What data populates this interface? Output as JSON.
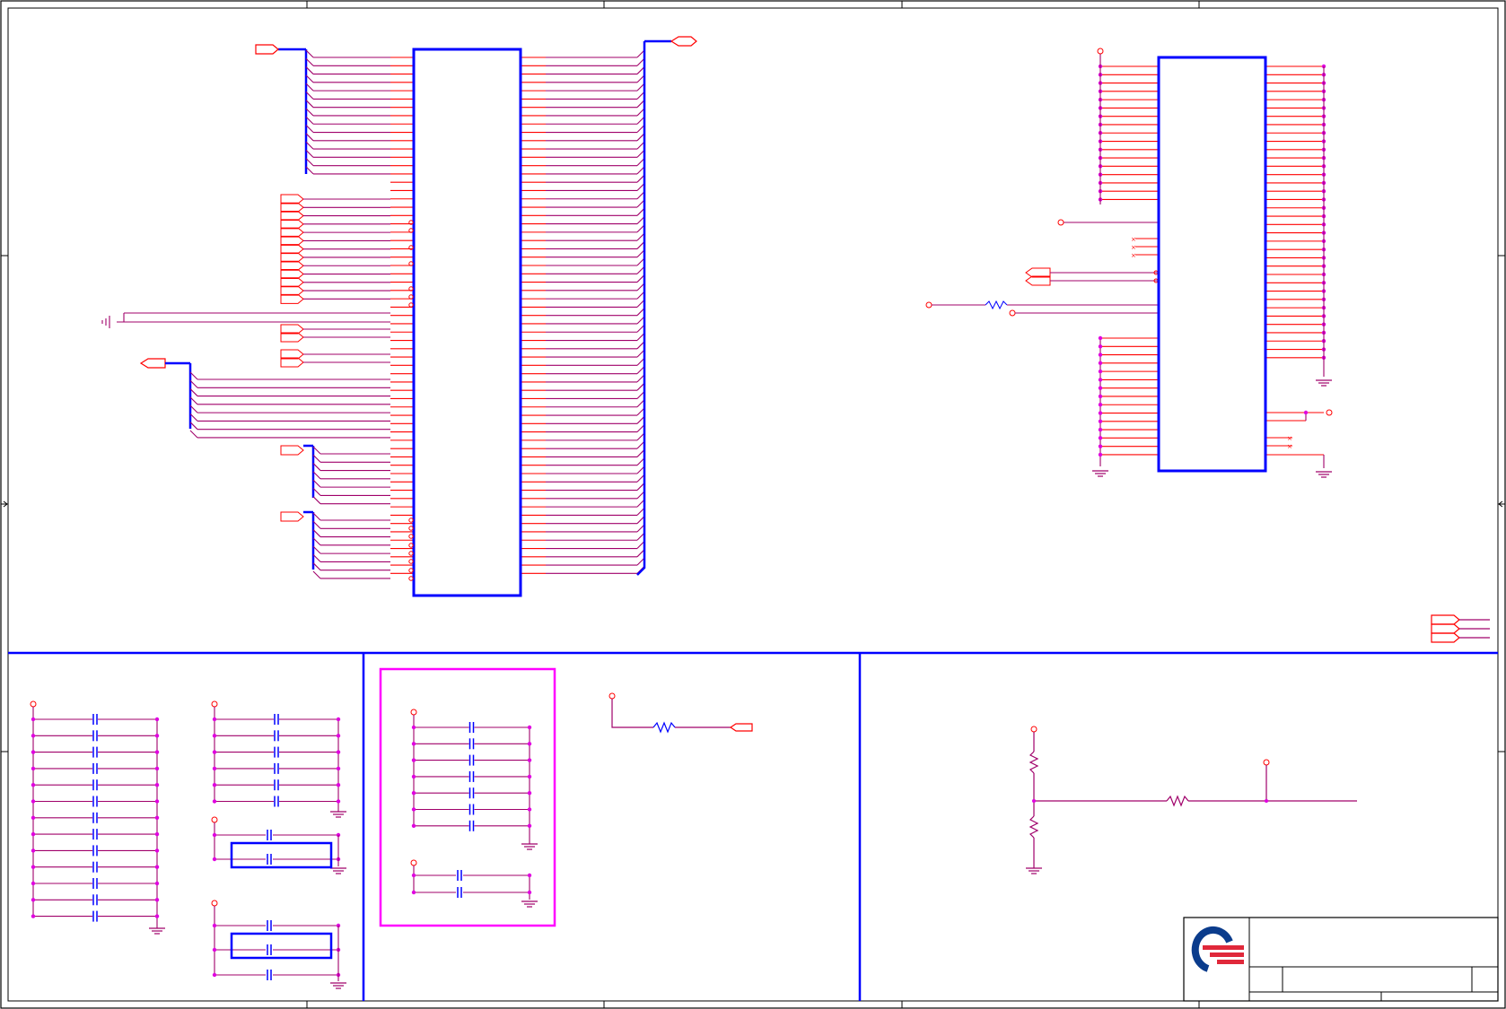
{
  "sheet": {
    "type": "electrical schematic",
    "texts": []
  },
  "colors": {
    "wire": "#a0006a",
    "pin": "#ff0000",
    "component": "#0000ff",
    "junction": "#e000e0",
    "border": "#000000",
    "highlight_box": "#ff00ff",
    "logo_blue": "#0b3c8c",
    "logo_red": "#e0283a"
  },
  "icons": [
    "ground-symbol",
    "power-port",
    "net-port",
    "capacitor",
    "resistor",
    "no-connect-mark",
    "company-logo"
  ]
}
